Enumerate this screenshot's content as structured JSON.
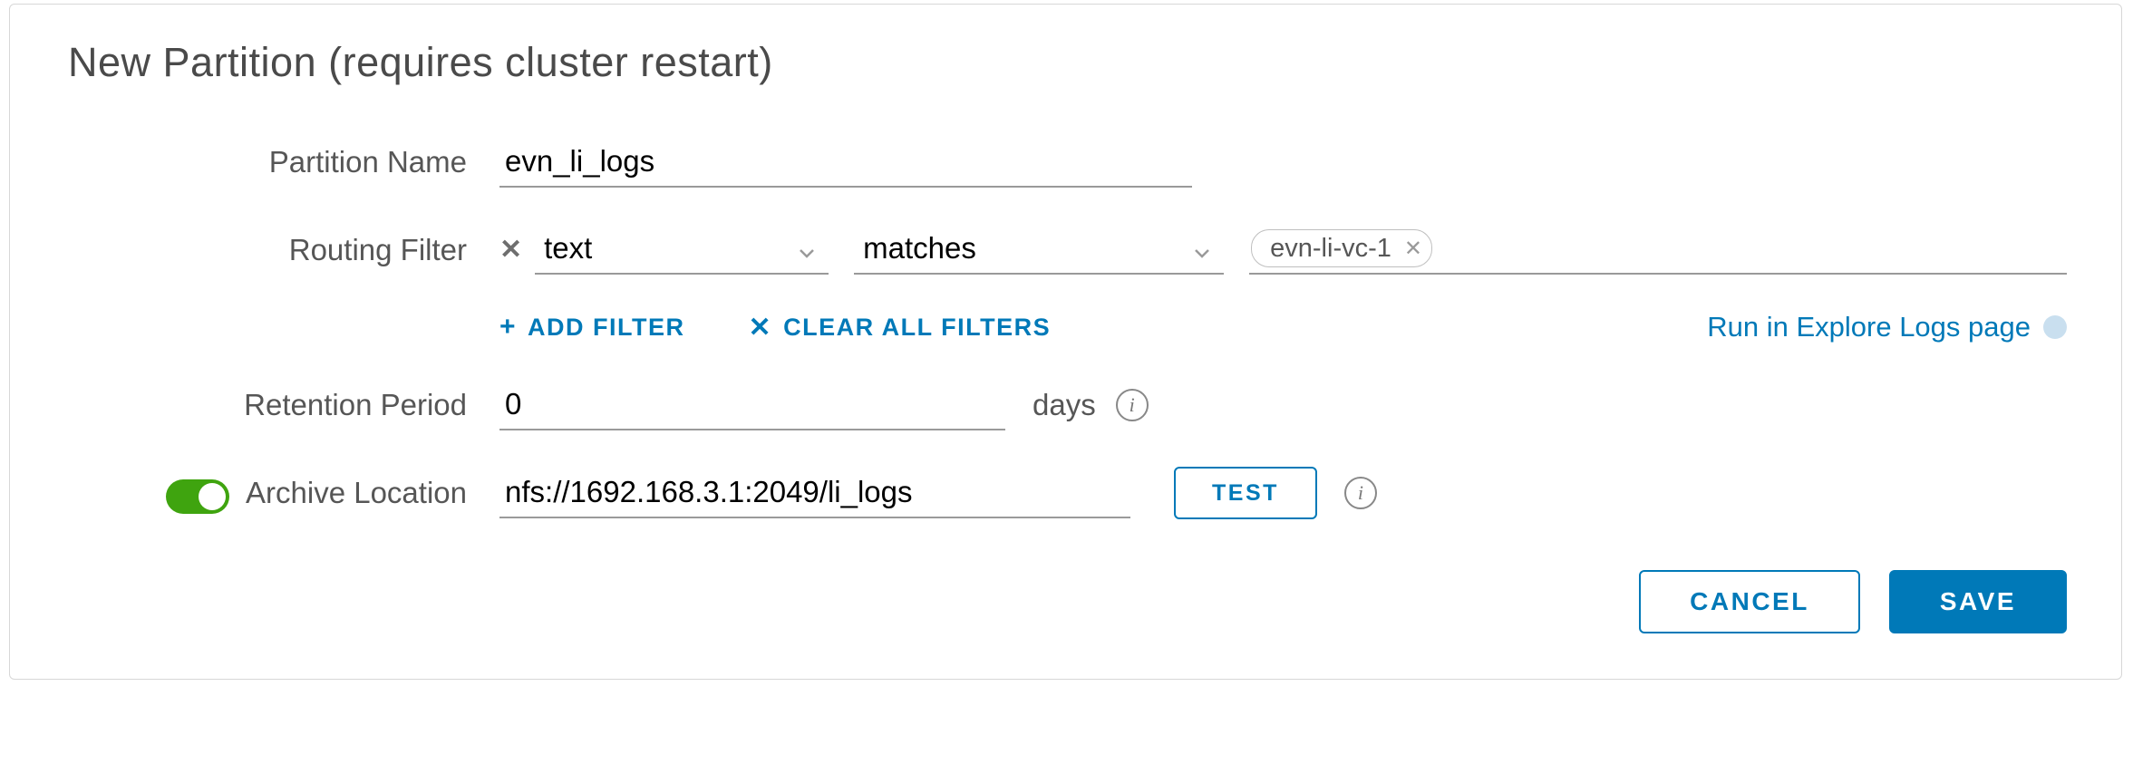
{
  "title": "New Partition (requires cluster restart)",
  "labels": {
    "partition_name": "Partition Name",
    "routing_filter": "Routing Filter",
    "retention_period": "Retention Period",
    "archive_location": "Archive Location"
  },
  "partition_name_value": "evn_li_logs",
  "routing_filter": {
    "field": "text",
    "operator": "matches",
    "tag": "evn-li-vc-1"
  },
  "filter_actions": {
    "add": "ADD FILTER",
    "clear": "CLEAR ALL FILTERS",
    "run_link": "Run in Explore Logs page"
  },
  "retention": {
    "value": "0",
    "unit": "days"
  },
  "archive": {
    "enabled": true,
    "value": "nfs://1692.168.3.1:2049/li_logs",
    "test_label": "TEST"
  },
  "footer": {
    "cancel": "CANCEL",
    "save": "SAVE"
  }
}
